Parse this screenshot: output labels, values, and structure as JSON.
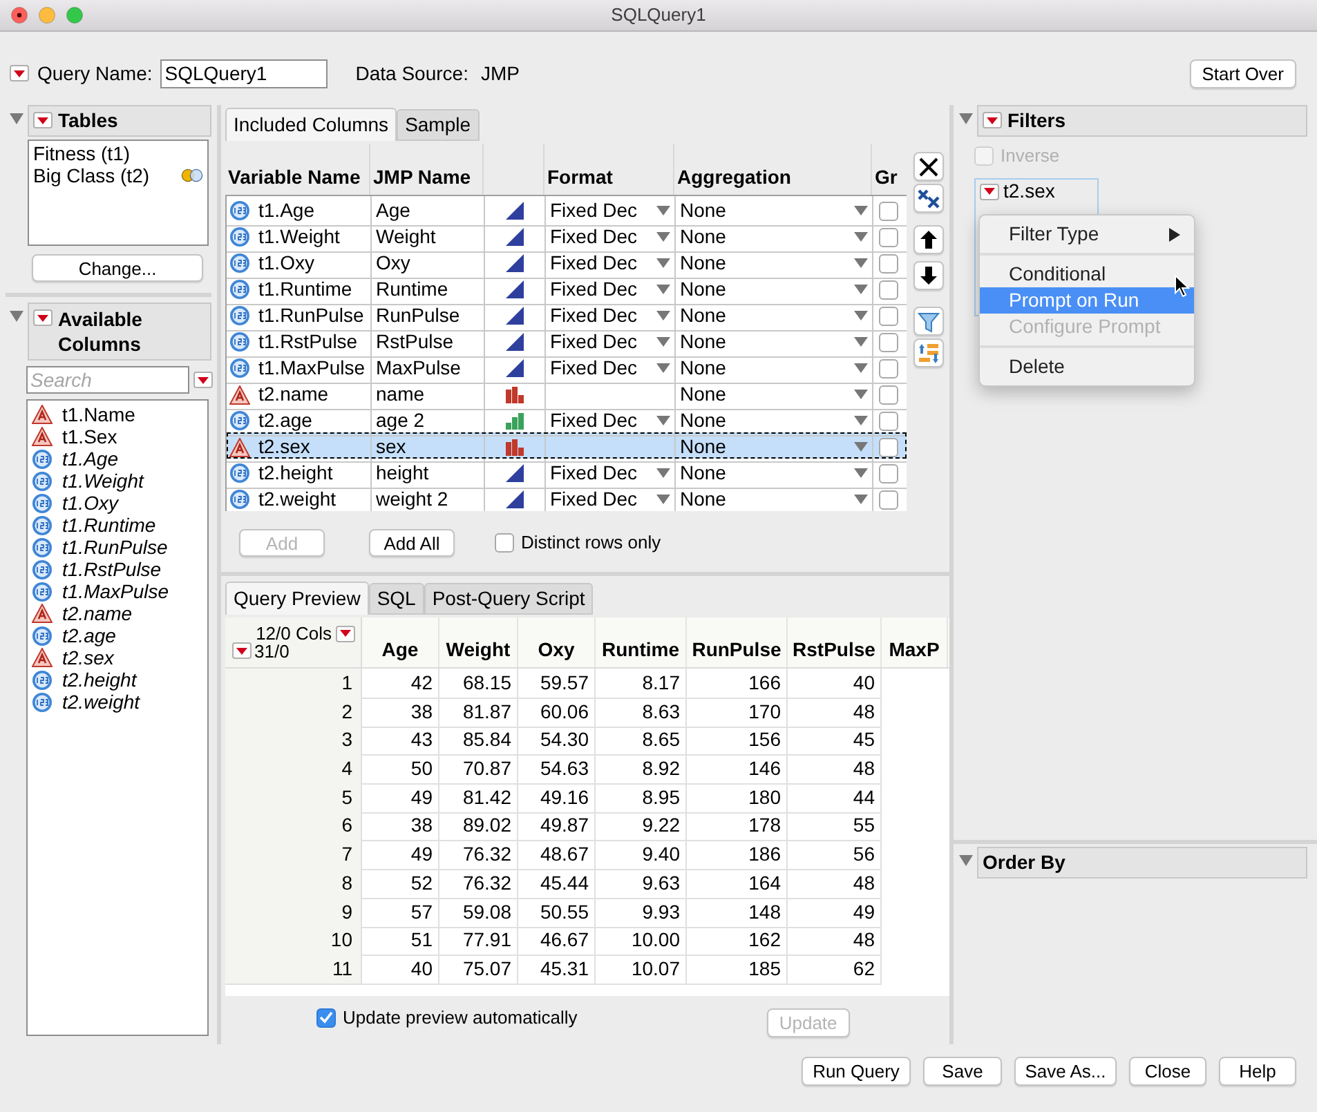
{
  "window": {
    "title": "SQLQuery1"
  },
  "query_name": {
    "label": "Query Name:",
    "value": "SQLQuery1"
  },
  "data_source": {
    "label": "Data Source:",
    "value": "JMP"
  },
  "start_over": "Start Over",
  "tables": {
    "title": "Tables",
    "expanded": true,
    "items": [
      {
        "name": "Fitness (t1)",
        "joined": false
      },
      {
        "name": "Big Class (t2)",
        "joined": true
      }
    ],
    "change_button": "Change..."
  },
  "available_columns": {
    "title": "Available Columns",
    "expanded": true,
    "search_placeholder": "Search",
    "items": [
      {
        "name": "t1.Name",
        "kind": "character",
        "italic": false
      },
      {
        "name": "t1.Sex",
        "kind": "character",
        "italic": false
      },
      {
        "name": "t1.Age",
        "kind": "numeric",
        "italic": true
      },
      {
        "name": "t1.Weight",
        "kind": "numeric",
        "italic": true
      },
      {
        "name": "t1.Oxy",
        "kind": "numeric",
        "italic": true
      },
      {
        "name": "t1.Runtime",
        "kind": "numeric",
        "italic": true
      },
      {
        "name": "t1.RunPulse",
        "kind": "numeric",
        "italic": true
      },
      {
        "name": "t1.RstPulse",
        "kind": "numeric",
        "italic": true
      },
      {
        "name": "t1.MaxPulse",
        "kind": "numeric",
        "italic": true
      },
      {
        "name": "t2.name",
        "kind": "character",
        "italic": true
      },
      {
        "name": "t2.age",
        "kind": "numeric",
        "italic": true
      },
      {
        "name": "t2.sex",
        "kind": "character",
        "italic": true
      },
      {
        "name": "t2.height",
        "kind": "numeric",
        "italic": true
      },
      {
        "name": "t2.weight",
        "kind": "numeric",
        "italic": true
      }
    ]
  },
  "column_tabs": [
    {
      "label": "Included Columns",
      "selected": true
    },
    {
      "label": "Sample",
      "selected": false
    }
  ],
  "included_columns": {
    "columns": [
      "Variable Name",
      "JMP Name",
      "Format",
      "Aggregation",
      "Gr"
    ],
    "rows": [
      {
        "kind": "numeric",
        "variable": "t1.Age",
        "jmp_name": "Age",
        "modeling": {
          "kind": "continuous"
        },
        "format": "Fixed Dec",
        "aggregation": "None",
        "group": false,
        "selected": false
      },
      {
        "kind": "numeric",
        "variable": "t1.Weight",
        "jmp_name": "Weight",
        "modeling": {
          "kind": "continuous"
        },
        "format": "Fixed Dec",
        "aggregation": "None",
        "group": false,
        "selected": false
      },
      {
        "kind": "numeric",
        "variable": "t1.Oxy",
        "jmp_name": "Oxy",
        "modeling": {
          "kind": "continuous"
        },
        "format": "Fixed Dec",
        "aggregation": "None",
        "group": false,
        "selected": false
      },
      {
        "kind": "numeric",
        "variable": "t1.Runtime",
        "jmp_name": "Runtime",
        "modeling": {
          "kind": "continuous"
        },
        "format": "Fixed Dec",
        "aggregation": "None",
        "group": false,
        "selected": false
      },
      {
        "kind": "numeric",
        "variable": "t1.RunPulse",
        "jmp_name": "RunPulse",
        "modeling": {
          "kind": "continuous"
        },
        "format": "Fixed Dec",
        "aggregation": "None",
        "group": false,
        "selected": false
      },
      {
        "kind": "numeric",
        "variable": "t1.RstPulse",
        "jmp_name": "RstPulse",
        "modeling": {
          "kind": "continuous"
        },
        "format": "Fixed Dec",
        "aggregation": "None",
        "group": false,
        "selected": false
      },
      {
        "kind": "numeric",
        "variable": "t1.MaxPulse",
        "jmp_name": "MaxPulse",
        "modeling": {
          "kind": "continuous"
        },
        "format": "Fixed Dec",
        "aggregation": "None",
        "group": false,
        "selected": false
      },
      {
        "kind": "character",
        "variable": "t2.name",
        "jmp_name": "name",
        "modeling": {
          "kind": "nominal"
        },
        "aggregation": "None",
        "group": false,
        "selected": false
      },
      {
        "kind": "numeric",
        "variable": "t2.age",
        "jmp_name": "age 2",
        "modeling": {
          "kind": "ordinal"
        },
        "format": "Fixed Dec",
        "aggregation": "None",
        "group": false,
        "selected": false
      },
      {
        "kind": "character",
        "variable": "t2.sex",
        "jmp_name": "sex",
        "modeling": {
          "kind": "nominal"
        },
        "aggregation": "None",
        "group": false,
        "selected": true
      },
      {
        "kind": "numeric",
        "variable": "t2.height",
        "jmp_name": "height",
        "modeling": {
          "kind": "continuous"
        },
        "format": "Fixed Dec",
        "aggregation": "None",
        "group": false,
        "selected": false
      },
      {
        "kind": "numeric",
        "variable": "t2.weight",
        "jmp_name": "weight 2",
        "modeling": {
          "kind": "continuous"
        },
        "format": "Fixed Dec",
        "aggregation": "None",
        "group": false,
        "selected": false
      }
    ]
  },
  "add_button": {
    "label": "Add",
    "disabled": true
  },
  "add_all_button": {
    "label": "Add All",
    "disabled": false
  },
  "distinct_rows": {
    "label": "Distinct rows only",
    "checked": false
  },
  "preview_tabs": [
    {
      "label": "Query Preview",
      "selected": true
    },
    {
      "label": "SQL",
      "selected": false
    },
    {
      "label": "Post-Query Script",
      "selected": false
    }
  ],
  "preview": {
    "cols_count": "12/0 Cols",
    "rows_count": "31/0",
    "columns": [
      "Age",
      "Weight",
      "Oxy",
      "Runtime",
      "RunPulse",
      "RstPulse",
      "MaxP"
    ],
    "rows": [
      {
        "row_number": "1",
        "cells": [
          "42",
          "68.15",
          "59.57",
          "8.17",
          "166",
          "40"
        ]
      },
      {
        "row_number": "2",
        "cells": [
          "38",
          "81.87",
          "60.06",
          "8.63",
          "170",
          "48"
        ]
      },
      {
        "row_number": "3",
        "cells": [
          "43",
          "85.84",
          "54.30",
          "8.65",
          "156",
          "45"
        ]
      },
      {
        "row_number": "4",
        "cells": [
          "50",
          "70.87",
          "54.63",
          "8.92",
          "146",
          "48"
        ]
      },
      {
        "row_number": "5",
        "cells": [
          "49",
          "81.42",
          "49.16",
          "8.95",
          "180",
          "44"
        ]
      },
      {
        "row_number": "6",
        "cells": [
          "38",
          "89.02",
          "49.87",
          "9.22",
          "178",
          "55"
        ]
      },
      {
        "row_number": "7",
        "cells": [
          "49",
          "76.32",
          "48.67",
          "9.40",
          "186",
          "56"
        ]
      },
      {
        "row_number": "8",
        "cells": [
          "52",
          "76.32",
          "45.44",
          "9.63",
          "164",
          "48"
        ]
      },
      {
        "row_number": "9",
        "cells": [
          "57",
          "59.08",
          "50.55",
          "9.93",
          "148",
          "49"
        ]
      },
      {
        "row_number": "10",
        "cells": [
          "51",
          "77.91",
          "46.67",
          "10.00",
          "162",
          "48"
        ]
      },
      {
        "row_number": "11",
        "cells": [
          "40",
          "75.07",
          "45.31",
          "10.07",
          "185",
          "62"
        ]
      }
    ]
  },
  "update_automatically": {
    "label": "Update preview automatically",
    "checked": true
  },
  "update_button": {
    "label": "Update",
    "disabled": true
  },
  "filters": {
    "title": "Filters",
    "expanded": true,
    "inverse": {
      "label": "Inverse",
      "checked": false,
      "disabled": true
    },
    "filter_label": "t2.sex"
  },
  "context_menu": [
    {
      "kind": "submenu",
      "label": "Filter Type",
      "disabled": false,
      "selected": false
    },
    {
      "kind": "separator"
    },
    {
      "kind": "item",
      "label": "Conditional",
      "disabled": false,
      "selected": false
    },
    {
      "kind": "item",
      "label": "Prompt on Run",
      "disabled": false,
      "selected": true
    },
    {
      "kind": "item",
      "label": "Configure Prompt",
      "disabled": true,
      "selected": false
    },
    {
      "kind": "separator"
    },
    {
      "kind": "item",
      "label": "Delete",
      "disabled": false,
      "selected": false
    }
  ],
  "order_by": {
    "title": "Order By",
    "expanded": true
  },
  "footer_buttons": [
    "Run Query",
    "Save",
    "Save As...",
    "Close",
    "Help"
  ]
}
